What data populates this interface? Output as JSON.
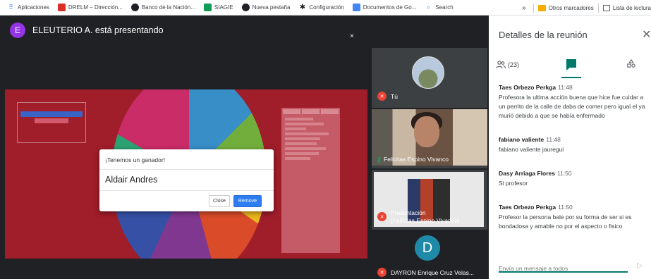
{
  "bookmarks": {
    "items": [
      {
        "label": "Aplicaciones",
        "icon": "apps-grid-icon",
        "color": "#4285f4"
      },
      {
        "label": "DRELM – Dirección...",
        "icon": "drelm-bookmark-icon",
        "color": "#d93025"
      },
      {
        "label": "Banco de la Nación...",
        "icon": "globe-icon",
        "color": "#202124"
      },
      {
        "label": "SIAGIE",
        "icon": "siagie-bookmark-icon",
        "color": "#0f9d58"
      },
      {
        "label": "Nueva pestaña",
        "icon": "globe-icon",
        "color": "#202124"
      },
      {
        "label": "Configuración",
        "icon": "gear-icon",
        "color": "#202124"
      },
      {
        "label": "Documentos de Go...",
        "icon": "docs-icon",
        "color": "#4285f4"
      },
      {
        "label": "Search",
        "icon": "search-icon",
        "color": "#4285f4"
      }
    ],
    "more": "»",
    "other": "Otros marcadores",
    "reading_list": "Lista de lectura"
  },
  "presenter": {
    "avatar_letter": "E",
    "label": "ELEUTERIO A. está presentando"
  },
  "shared_screen": {
    "close_glyph": "×",
    "modal": {
      "header": "¡Tenemos un ganador!",
      "winner": "Aldair Andres",
      "close_label": "Close",
      "remove_label": "Remove"
    }
  },
  "tiles": {
    "you": "Tú",
    "felicitas": "Felicitas Espino Vivanco",
    "presentation_line1": "Presentación",
    "presentation_line2": "(Felicitas Espino Vivanco)",
    "dayron_letter": "D",
    "dayron": "DAYRON Enrique Cruz Velas..."
  },
  "panel": {
    "title": "Detalles de la reunión",
    "people_count": "(23)",
    "messages": [
      {
        "author": "Taes Orbezo Perkga",
        "time": "11:48",
        "text": "Profesora la ultima acción buena que hice fue cuidar a un perrito de la calle de daba de comer pero igual el ya murió debido a que se había enfermado"
      },
      {
        "author": "fabiano valiente",
        "time": "11:48",
        "text": "fabiano valiente jauregui"
      },
      {
        "author": "Dasy Arriaga Flores",
        "time": "11:50",
        "text": "Si profesor"
      },
      {
        "author": "Taes Orbezo Perkga",
        "time": "11:50",
        "text": "Profesor la persona bale por su forma de ser si es bondadosa y amable no por el aspecto o fisico"
      }
    ],
    "composer_placeholder": "Envía un mensaje a todos"
  },
  "colors": {
    "accent": "#00796b",
    "mic_off": "#ea4335",
    "remove_button": "#2d7df0"
  }
}
